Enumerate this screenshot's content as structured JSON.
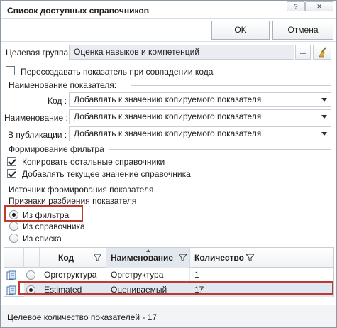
{
  "window": {
    "title": "Список доступных справочников",
    "help_glyph": "?",
    "close_glyph": "✕"
  },
  "buttons": {
    "ok": "OK",
    "cancel": "Отмена"
  },
  "target_group": {
    "label": "Целевая группа:",
    "value": "Оценка навыков и компетенций",
    "browse": "..."
  },
  "recreate_checkbox": {
    "label": "Пересоздавать показатель при совпадении кода",
    "checked": false
  },
  "naming": {
    "header": "Наименование показателя:",
    "fields": [
      {
        "label": "Код :",
        "value": "Добавлять к значению копируемого показателя"
      },
      {
        "label": "Наименование :",
        "value": "Добавлять к значению копируемого показателя"
      },
      {
        "label": "В публикации :",
        "value": "Добавлять к значению копируемого показателя"
      }
    ]
  },
  "filter": {
    "header": "Формирование фильтра",
    "options": [
      {
        "label": "Копировать остальные справочники",
        "checked": true
      },
      {
        "label": "Добавлять текущее значение справочника",
        "checked": true
      }
    ]
  },
  "source": {
    "header": "Источник формирования показателя",
    "sub_header": "Признаки разбиения показателя",
    "radios": [
      {
        "label": "Из фильтра",
        "selected": true
      },
      {
        "label": "Из справочника",
        "selected": false
      },
      {
        "label": "Из списка",
        "selected": false
      }
    ]
  },
  "grid": {
    "columns": [
      "Код",
      "Наименование",
      "Количество"
    ],
    "rows": [
      {
        "code": "Оргструктура",
        "name": "Оргструктура",
        "count": "1",
        "selected": false
      },
      {
        "code": "Estimated",
        "name": "Оцениваемый",
        "count": "17",
        "selected": true
      }
    ]
  },
  "status": {
    "text": "Целевое количество показателей - 17"
  },
  "colors": {
    "highlight": "#c0392b",
    "field_bg": "#e9edf1",
    "border": "#c8ced6"
  }
}
